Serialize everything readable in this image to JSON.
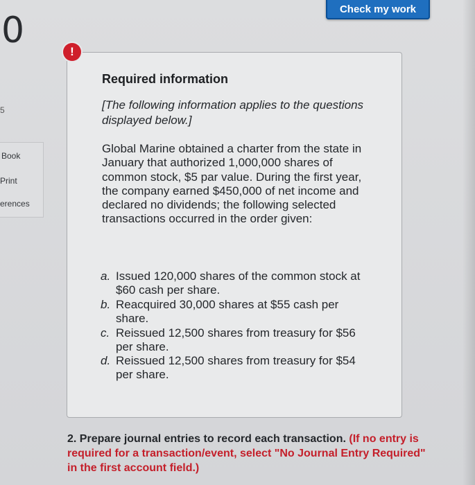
{
  "header": {
    "check_button_label": "Check my work",
    "question_number_fragment": "0",
    "points_fragment": "5"
  },
  "sidebar": {
    "items": [
      {
        "label": "Book"
      },
      {
        "label": "Print"
      },
      {
        "label": "erences"
      }
    ]
  },
  "alert": {
    "icon_text": "!"
  },
  "info_box": {
    "heading": "Required information",
    "intro": "[The following information applies to the questions displayed below.]",
    "body": "Global Marine obtained a charter from the state in January that authorized 1,000,000 shares of common stock, $5 par value. During the first year, the company earned $450,000 of net income and declared no dividends; the following selected transactions occurred in the order given:",
    "transactions": [
      {
        "letter": "a.",
        "text": "Issued 120,000 shares of the common stock at $60 cash per share."
      },
      {
        "letter": "b.",
        "text": "Reacquired 30,000 shares at $55 cash per share."
      },
      {
        "letter": "c.",
        "text": "Reissued 12,500 shares from treasury for $56 per share."
      },
      {
        "letter": "d.",
        "text": "Reissued 12,500 shares from treasury for $54 per share."
      }
    ]
  },
  "question": {
    "prompt": "2. Prepare journal entries to record each transaction.",
    "instruction": "(If no entry is required for a transaction/event, select \"No Journal Entry Required\" in the first account field.)"
  },
  "colors": {
    "button_blue": "#1f6fbf",
    "alert_red": "#cf1f2b",
    "instruction_red": "#c41f2a"
  }
}
